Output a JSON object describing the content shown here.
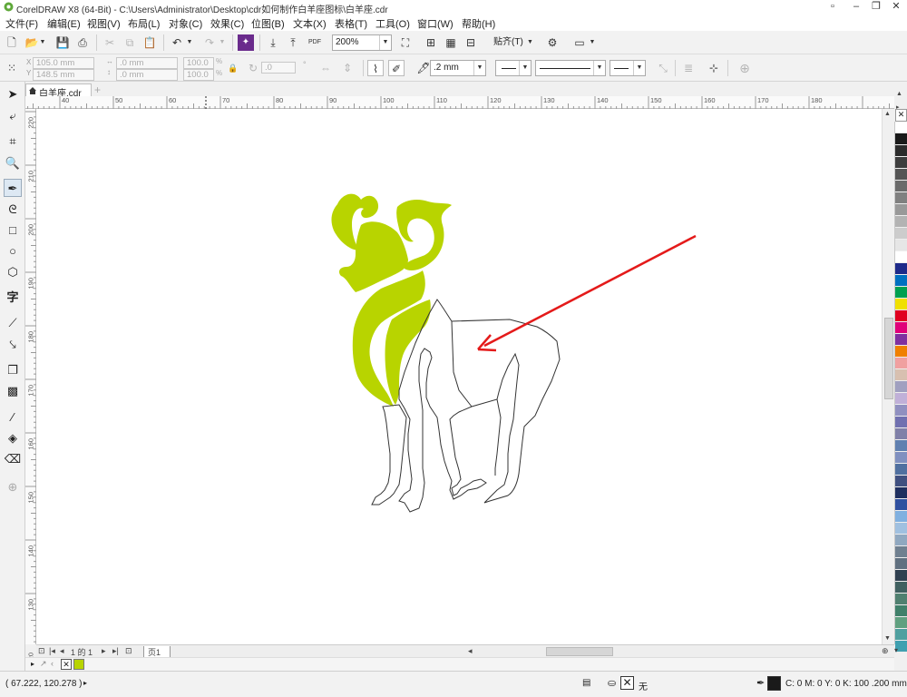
{
  "window": {
    "title": "CorelDRAW X8 (64-Bit) - C:\\Users\\Administrator\\Desktop\\cdr如何制作白羊座图标\\白羊座.cdr"
  },
  "menu": [
    "文件(F)",
    "编辑(E)",
    "视图(V)",
    "布局(L)",
    "对象(C)",
    "效果(C)",
    "位图(B)",
    "文本(X)",
    "表格(T)",
    "工具(O)",
    "窗口(W)",
    "帮助(H)"
  ],
  "toolbar": {
    "pdf_label": "PDF",
    "zoom": "200%",
    "snap_label": "贴齐(T)"
  },
  "property_bar": {
    "x": "105.0 mm",
    "y": "148.5 mm",
    "width": ".0 mm",
    "height": ".0 mm",
    "scale_x": "100.0",
    "scale_y": "100.0",
    "percent_symbol": "%",
    "angle": ".0",
    "outline_width": ".2 mm"
  },
  "document_tab": "白羊座.cdr",
  "ruler": {
    "h_labels": [
      "40",
      "50",
      "60",
      "70",
      "80",
      "90",
      "100",
      "110",
      "120",
      "130",
      "140",
      "150",
      "160",
      "170",
      "180"
    ],
    "v_labels": [
      "220",
      "210",
      "200",
      "190",
      "180",
      "170",
      "160",
      "150",
      "140",
      "130",
      "120"
    ]
  },
  "page_nav": {
    "page_of": "1 的 1",
    "page_tab": "页1"
  },
  "status": {
    "coords": "( 67.222, 120.278 )",
    "fill_none": "无",
    "outline_color_info": "C: 0 M: 0 Y: 0 K: 100  .200 mm"
  },
  "colors": {
    "ram_fill": "#b8d400",
    "arrow": "#e41a1a",
    "outline": "#333333",
    "current_fill_swatch": "#b8d400",
    "outline_swatch": "#1a1a1a"
  },
  "palette": [
    "#ffffff",
    "#1a1a1a",
    "#2b2b2b",
    "#3d3d3d",
    "#555555",
    "#6b6b6b",
    "#808080",
    "#999999",
    "#b3b3b3",
    "#cccccc",
    "#e6e6e6",
    "#ffffff",
    "#1e2a8a",
    "#0070c0",
    "#00a050",
    "#f0e000",
    "#e00020",
    "#e0007a",
    "#8030a0",
    "#f08000",
    "#f0a0a0",
    "#d8c0b0",
    "#a0a0c0",
    "#c0b0d8",
    "#9090c0",
    "#7070b0",
    "#8080a8",
    "#6080b0",
    "#8090c0",
    "#5070a0",
    "#405080",
    "#1f2f5f",
    "#3050a0",
    "#80b0e0",
    "#a0c0e0",
    "#90a8c0",
    "#708090",
    "#607080",
    "#304050",
    "#406060",
    "#508070",
    "#40806a",
    "#60a080",
    "#50a0a0",
    "#40a0b0"
  ]
}
